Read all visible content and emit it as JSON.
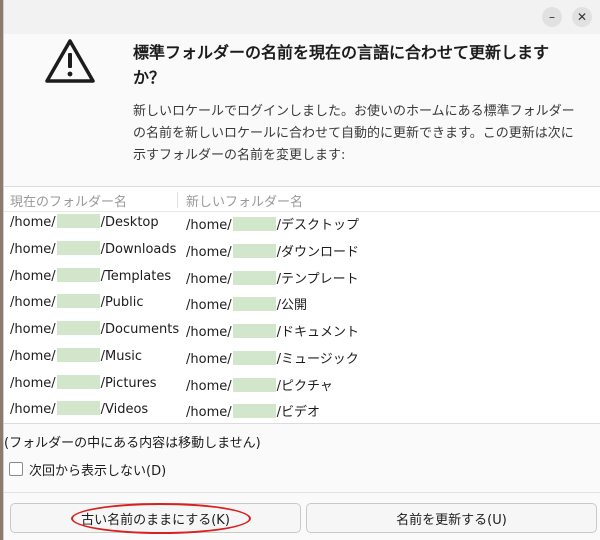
{
  "window": {
    "minimize_icon": "minimize-icon",
    "close_icon": "close-icon",
    "minimize_glyph": "–",
    "close_glyph": "✕"
  },
  "dialog": {
    "heading": "標準フォルダーの名前を現在の言語に合わせて更新しますか？",
    "description": "新しいロケールでログインしました。お使いのホームにある標準フォルダーの名前を新しいロケールに合わせて自動的に更新できます。この更新は次に示すフォルダーの名前を変更します:",
    "warning_icon": "warning-icon"
  },
  "table": {
    "columns": [
      "現在のフォルダー名",
      "新しいフォルダー名"
    ],
    "rows": [
      {
        "prefix": "/home/",
        "mask": "j",
        "current": "/Desktop",
        "new": "/デスクトップ"
      },
      {
        "prefix": "/home/",
        "mask": "j",
        "current": "/Downloads",
        "new": "/ダウンロード"
      },
      {
        "prefix": "/home/",
        "mask": "j",
        "current": "/Templates",
        "new": "/テンプレート"
      },
      {
        "prefix": "/home/",
        "mask": "j",
        "current": "/Public",
        "new": "/公開"
      },
      {
        "prefix": "/home/",
        "mask": "j",
        "current": "/Documents",
        "new": "/ドキュメント"
      },
      {
        "prefix": "/home/",
        "mask": "j",
        "current": "/Music",
        "new": "/ミュージック"
      },
      {
        "prefix": "/home/",
        "mask": "j",
        "current": "/Pictures",
        "new": "/ピクチャ"
      },
      {
        "prefix": "/home/",
        "mask": "j",
        "current": "/Videos",
        "new": "/ビデオ"
      }
    ]
  },
  "note": "(フォルダーの中にある内容は移動しません)",
  "checkbox": {
    "label": "次回から表示しない(D)",
    "checked": false
  },
  "buttons": {
    "keep_old": "古い名前のままにする(K)",
    "update": "名前を更新する(U)"
  },
  "colors": {
    "annotation": "#d82020",
    "redaction": "#d2e6cc"
  }
}
